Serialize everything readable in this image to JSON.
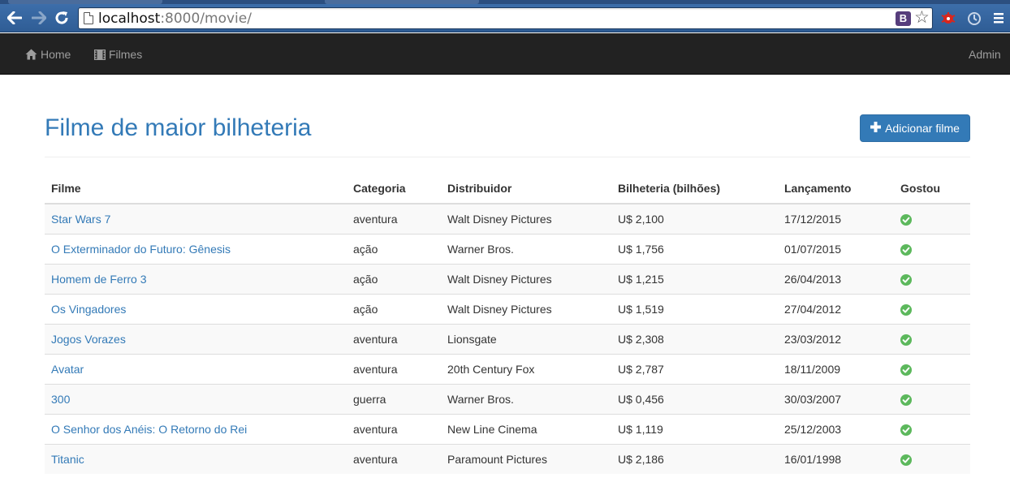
{
  "browser": {
    "url_host": "localhost",
    "url_path": ":8000/movie/",
    "ext_badge": "B"
  },
  "navbar": {
    "home_label": "Home",
    "films_label": "Filmes",
    "admin_label": "Admin",
    "bg_color": "#222222"
  },
  "page": {
    "title": "Filme de maior bilheteria",
    "add_button_label": "Adicionar filme",
    "accent_color": "#337ab7",
    "liked_icon": "ok-sign-icon",
    "liked_color": "#5cb85c"
  },
  "table": {
    "headers": [
      "Filme",
      "Categoria",
      "Distribuidor",
      "Bilheteria (bilhões)",
      "Lançamento",
      "Gostou"
    ],
    "rows": [
      {
        "film": "Star Wars 7",
        "category": "aventura",
        "distributor": "Walt Disney Pictures",
        "box_office": "U$ 2,100",
        "release": "17/12/2015",
        "liked": true
      },
      {
        "film": "O Exterminador do Futuro: Gênesis",
        "category": "ação",
        "distributor": "Warner Bros.",
        "box_office": "U$ 1,756",
        "release": "01/07/2015",
        "liked": true
      },
      {
        "film": "Homem de Ferro 3",
        "category": "ação",
        "distributor": "Walt Disney Pictures",
        "box_office": "U$ 1,215",
        "release": "26/04/2013",
        "liked": true
      },
      {
        "film": "Os Vingadores",
        "category": "ação",
        "distributor": "Walt Disney Pictures",
        "box_office": "U$ 1,519",
        "release": "27/04/2012",
        "liked": true
      },
      {
        "film": "Jogos Vorazes",
        "category": "aventura",
        "distributor": "Lionsgate",
        "box_office": "U$ 2,308",
        "release": "23/03/2012",
        "liked": true
      },
      {
        "film": "Avatar",
        "category": "aventura",
        "distributor": "20th Century Fox",
        "box_office": "U$ 2,787",
        "release": "18/11/2009",
        "liked": true
      },
      {
        "film": "300",
        "category": "guerra",
        "distributor": "Warner Bros.",
        "box_office": "U$ 0,456",
        "release": "30/03/2007",
        "liked": true
      },
      {
        "film": "O Senhor dos Anéis: O Retorno do Rei",
        "category": "aventura",
        "distributor": "New Line Cinema",
        "box_office": "U$ 1,119",
        "release": "25/12/2003",
        "liked": true
      },
      {
        "film": "Titanic",
        "category": "aventura",
        "distributor": "Paramount Pictures",
        "box_office": "U$ 2,186",
        "release": "16/01/1998",
        "liked": true
      }
    ]
  }
}
